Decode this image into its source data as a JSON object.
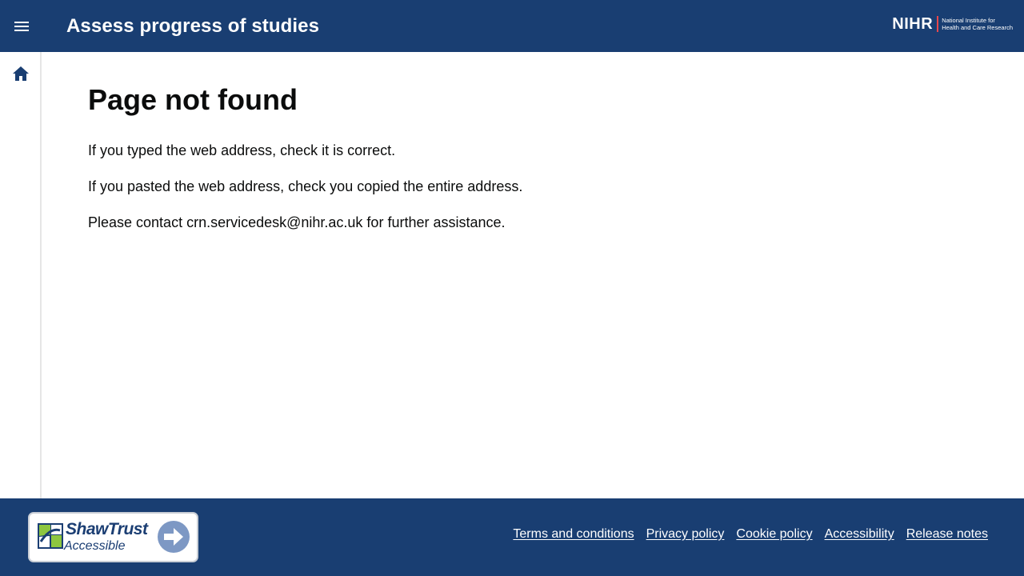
{
  "header": {
    "title": "Assess progress of studies",
    "menu_icon": "hamburger-menu-icon",
    "logo": {
      "mark": "NIHR",
      "line1": "National Institute for",
      "line2": "Health and Care Research",
      "divider_color": "#e8474c"
    }
  },
  "sidebar": {
    "home_icon": "home-icon"
  },
  "main": {
    "title": "Page not found",
    "paragraphs": [
      "If you typed the web address, check it is correct.",
      "If you pasted the web address, check you copied the entire address.",
      "Please contact crn.servicedesk@nihr.ac.uk for further assistance."
    ]
  },
  "footer": {
    "badge": {
      "name": "ShawTrust",
      "sub": "Accessible"
    },
    "links": [
      "Terms and conditions",
      "Privacy policy",
      "Cookie policy",
      "Accessibility",
      "Release notes"
    ]
  },
  "colors": {
    "brand": "#193e72",
    "text": "#0b0c0c",
    "background": "#ffffff"
  }
}
